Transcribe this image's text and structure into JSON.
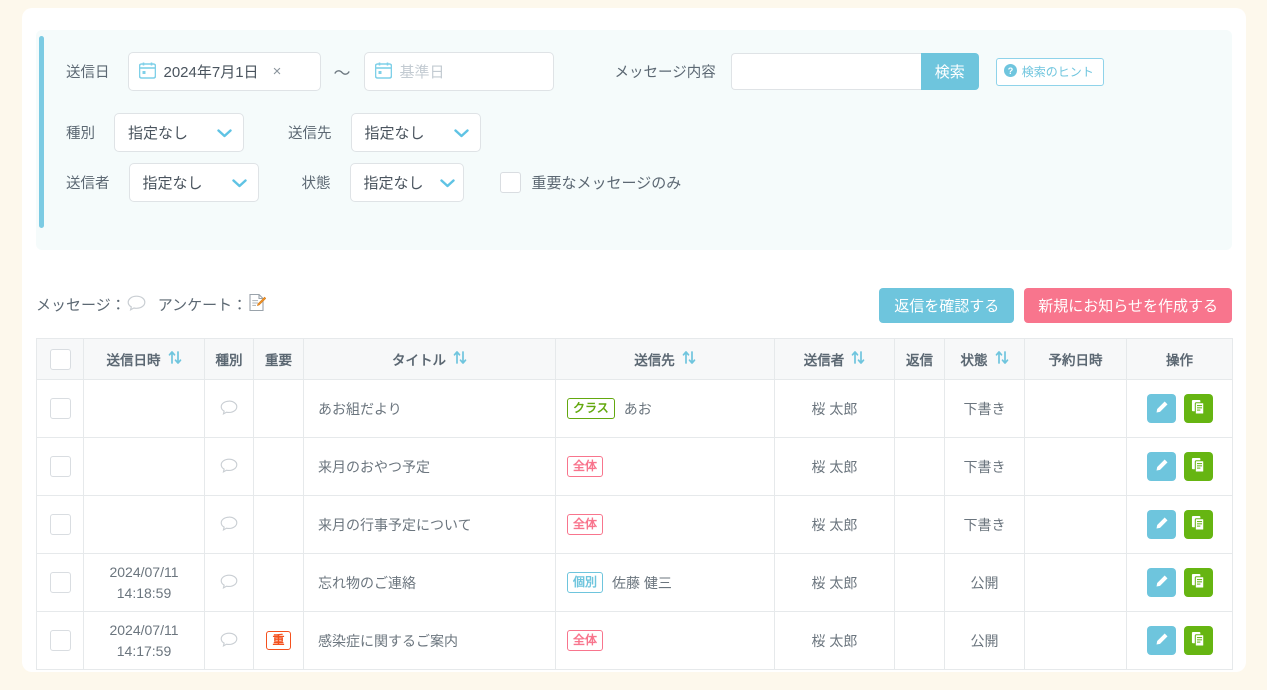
{
  "filters": {
    "send_date": {
      "label": "送信日",
      "from_value": "2024年7月1日",
      "from_clear": "×",
      "separator": "～",
      "to_placeholder": "基準日",
      "to_value": "",
      "calendar_icon": "calendar-icon"
    },
    "message_body": {
      "label": "メッセージ内容",
      "input_value": "",
      "input_placeholder": "",
      "search_button": "検索"
    },
    "search_hint": {
      "label": "検索のヒント",
      "icon": "question-circle-icon"
    },
    "type": {
      "label": "種別",
      "value": "指定なし"
    },
    "destination": {
      "label": "送信先",
      "value": "指定なし"
    },
    "sender": {
      "label": "送信者",
      "value": "指定なし"
    },
    "status": {
      "label": "状態",
      "value": "指定なし"
    },
    "important_only": {
      "label": "重要なメッセージのみ",
      "checked": false
    }
  },
  "legend": {
    "message_label": "メッセージ：",
    "message_icon": "speech-bubble-icon",
    "survey_label": "アンケート：",
    "survey_icon": "memo-pencil-icon"
  },
  "actions": {
    "check_replies": "返信を確認する",
    "create_notice": "新規にお知らせを作成する"
  },
  "table": {
    "columns": [
      {
        "key": "checkbox",
        "label": "",
        "sortable": false
      },
      {
        "key": "sent_at",
        "label": "送信日時",
        "sortable": true
      },
      {
        "key": "type",
        "label": "種別",
        "sortable": false
      },
      {
        "key": "important",
        "label": "重要",
        "sortable": false
      },
      {
        "key": "title",
        "label": "タイトル",
        "sortable": true
      },
      {
        "key": "dest",
        "label": "送信先",
        "sortable": true
      },
      {
        "key": "sender",
        "label": "送信者",
        "sortable": true
      },
      {
        "key": "reply",
        "label": "返信",
        "sortable": false
      },
      {
        "key": "status",
        "label": "状態",
        "sortable": true
      },
      {
        "key": "scheduled",
        "label": "予約日時",
        "sortable": false
      },
      {
        "key": "ops",
        "label": "操作",
        "sortable": false
      }
    ],
    "rows": [
      {
        "sent_at": "",
        "sent_at_line2": "",
        "type_icon": "speech-bubble-icon",
        "important": "",
        "title": "あお組だより",
        "dest_badge": "クラス",
        "dest_badge_kind": "class",
        "dest_name": "あお",
        "sender": "桜 太郎",
        "reply": "",
        "status": "下書き",
        "scheduled": ""
      },
      {
        "sent_at": "",
        "sent_at_line2": "",
        "type_icon": "speech-bubble-icon",
        "important": "",
        "title": "来月のおやつ予定",
        "dest_badge": "全体",
        "dest_badge_kind": "all",
        "dest_name": "",
        "sender": "桜 太郎",
        "reply": "",
        "status": "下書き",
        "scheduled": ""
      },
      {
        "sent_at": "",
        "sent_at_line2": "",
        "type_icon": "speech-bubble-icon",
        "important": "",
        "title": "来月の行事予定について",
        "dest_badge": "全体",
        "dest_badge_kind": "all",
        "dest_name": "",
        "sender": "桜 太郎",
        "reply": "",
        "status": "下書き",
        "scheduled": ""
      },
      {
        "sent_at": "2024/07/11",
        "sent_at_line2": "14:18:59",
        "type_icon": "speech-bubble-icon",
        "important": "",
        "title": "忘れ物のご連絡",
        "dest_badge": "個別",
        "dest_badge_kind": "indiv",
        "dest_name": "佐藤 健三",
        "sender": "桜 太郎",
        "reply": "",
        "status": "公開",
        "scheduled": ""
      },
      {
        "sent_at": "2024/07/11",
        "sent_at_line2": "14:17:59",
        "type_icon": "speech-bubble-icon",
        "important": "重",
        "title": "感染症に関するご案内",
        "dest_badge": "全体",
        "dest_badge_kind": "all",
        "dest_name": "",
        "sender": "桜 太郎",
        "reply": "",
        "status": "公開",
        "scheduled": ""
      }
    ],
    "ops": {
      "edit_icon": "pencil-icon",
      "copy_icon": "duplicate-icon"
    }
  },
  "colors": {
    "page_bg": "#fdf8ec",
    "panel_bg": "#f5fbfb",
    "accent_blue": "#6ec5dd",
    "accent_pink": "#f8758d",
    "accent_green": "#66b512",
    "badge_class_green": "#63a80e",
    "important_orange": "#f4511e"
  }
}
